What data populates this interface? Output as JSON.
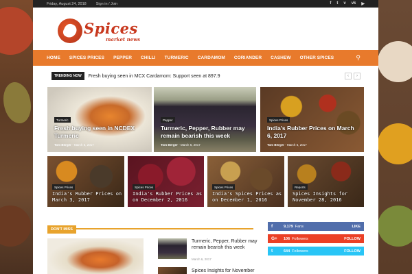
{
  "topbar": {
    "date": "Friday, August 24, 2018",
    "signin": "Sign in / Join",
    "social_icons": [
      "facebook-icon",
      "twitter-icon",
      "vimeo-icon",
      "vk-icon",
      "youtube-icon"
    ],
    "social_glyphs": [
      "f",
      "t",
      "v",
      "vk",
      "▶"
    ]
  },
  "logo": {
    "title": "Spices",
    "subtitle": "market news"
  },
  "nav": {
    "items": [
      "HOME",
      "SPICES PRICES",
      "PEPPER",
      "CHILLI",
      "TURMERIC",
      "CARDAMOM",
      "CORIANDER",
      "CASHEW",
      "OTHER SPICES"
    ]
  },
  "trending": {
    "tag": "TRENDING NOW",
    "text": "Fresh buying seen in MCX Cardamom: Support seen at 897.9",
    "prev": "‹",
    "next": "›"
  },
  "big_tiles": [
    {
      "category": "Turmeric",
      "title": "Fresh buying seen in NCDEX Turmeric",
      "author": "Tom Berger",
      "date": "March 6, 2017"
    },
    {
      "category": "Pepper",
      "title": "Turmeric, Pepper, Rubber may remain bearish this week",
      "author": "Tom Berger",
      "date": "March 6, 2017"
    },
    {
      "category": "Spices Prices",
      "title": "India's Rubber Prices on March 6, 2017",
      "author": "Tom Berger",
      "date": "March 6, 2017"
    }
  ],
  "small_tiles": [
    {
      "category": "Spices Prices",
      "title": "India's Rubber Prices on March 3, 2017"
    },
    {
      "category": "Spices Prices",
      "title": "India's Rubber Prices as on December 2, 2016"
    },
    {
      "category": "Spices Prices",
      "title": "India's Spices Prices as on December 1, 2016"
    },
    {
      "category": "Reports",
      "title": "Spices Insights for November 28, 2016"
    }
  ],
  "dont_miss": {
    "label": "DON'T MISS"
  },
  "side_list": [
    {
      "title": "Turmeric, Pepper, Rubber may remain bearish this week",
      "date": "March 6, 2017"
    },
    {
      "title": "Spices Insights for November"
    }
  ],
  "social_counters": [
    {
      "network": "facebook",
      "icon": "f",
      "count": "9,179",
      "label": "Fans",
      "action": "LIKE",
      "color": "#516eab"
    },
    {
      "network": "googleplus",
      "icon": "G+",
      "count": "106",
      "label": "Followers",
      "action": "FOLLOW",
      "color": "#eb4026"
    },
    {
      "network": "twitter",
      "icon": "t",
      "count": "644",
      "label": "Followers",
      "action": "FOLLOW",
      "color": "#29c5f6"
    }
  ],
  "colors": {
    "nav": "#e87a2c",
    "accent": "#e8a32c",
    "logo": "#c8381e",
    "topbar": "#222222"
  }
}
